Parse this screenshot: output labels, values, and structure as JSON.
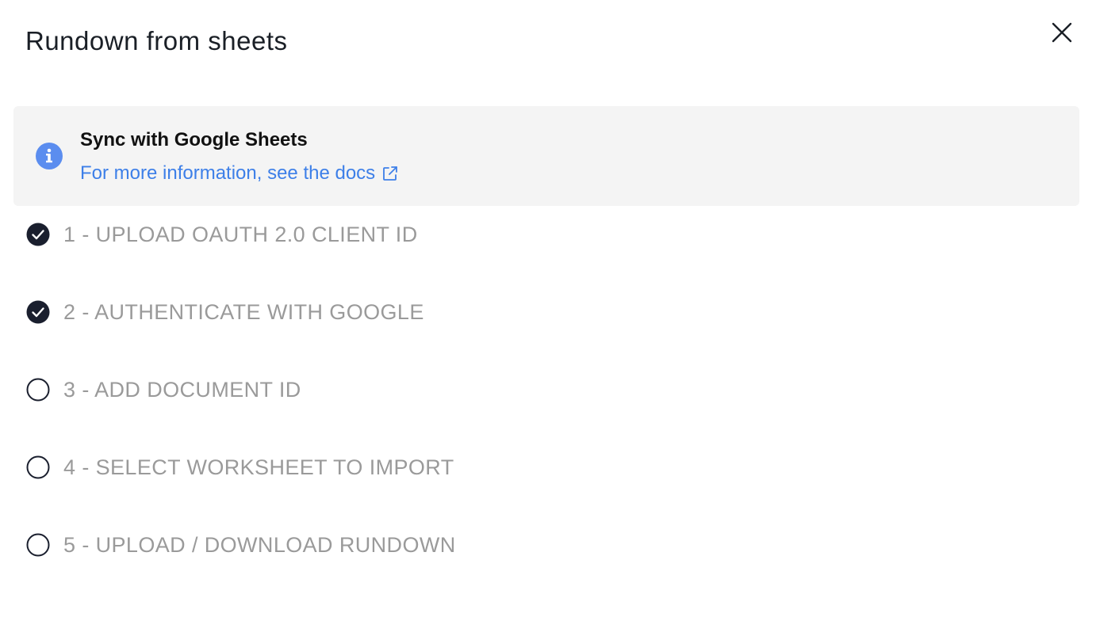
{
  "modal": {
    "title": "Rundown from sheets",
    "close_icon": "close-icon"
  },
  "info": {
    "icon": "info-icon",
    "title": "Sync with Google Sheets",
    "link_text": "For more information, see the docs",
    "link_icon": "external-link-icon",
    "accent_color": "#3d7fe8"
  },
  "steps": [
    {
      "label": "1 - UPLOAD OAUTH 2.0 CLIENT ID",
      "completed": true,
      "icon": "check-circle-icon"
    },
    {
      "label": "2 - AUTHENTICATE WITH GOOGLE",
      "completed": true,
      "icon": "check-circle-icon"
    },
    {
      "label": "3 - ADD DOCUMENT ID",
      "completed": false,
      "icon": "empty-circle-icon"
    },
    {
      "label": "4 - SELECT WORKSHEET TO IMPORT",
      "completed": false,
      "icon": "empty-circle-icon"
    },
    {
      "label": "5 - UPLOAD / DOWNLOAD RUNDOWN",
      "completed": false,
      "icon": "empty-circle-icon"
    }
  ],
  "colors": {
    "step_text": "#9a9a9a",
    "check_fill": "#1a1f2e",
    "info_bg": "#f4f4f4"
  }
}
